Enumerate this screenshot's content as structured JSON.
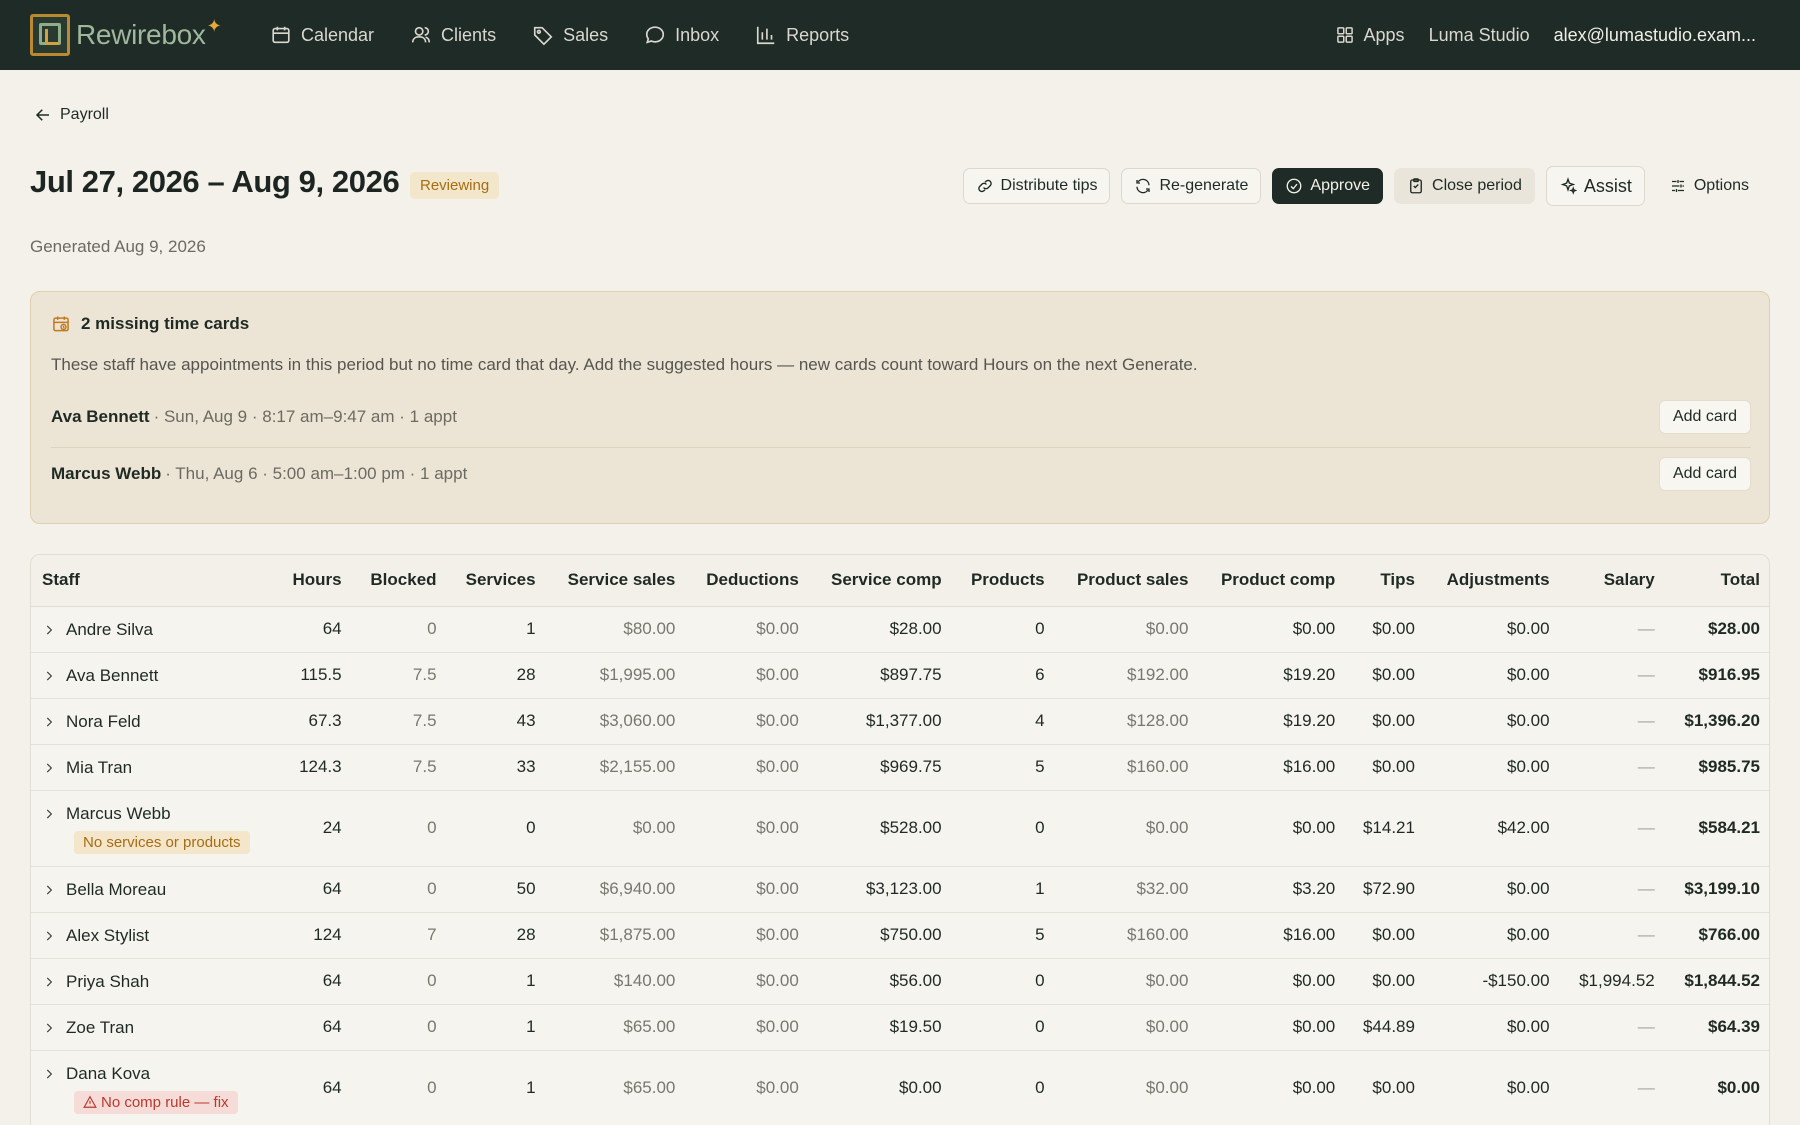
{
  "app": {
    "brand": "Rewirebox",
    "nav": [
      {
        "label": "Calendar",
        "icon": "calendar-icon"
      },
      {
        "label": "Clients",
        "icon": "users-icon"
      },
      {
        "label": "Sales",
        "icon": "tag-icon"
      },
      {
        "label": "Inbox",
        "icon": "chat-icon"
      },
      {
        "label": "Reports",
        "icon": "bar-chart-icon"
      }
    ],
    "apps_label": "Apps",
    "workspace": "Luma Studio",
    "user_email": "alex@lumastudio.exam..."
  },
  "breadcrumb": {
    "back_label": "Payroll"
  },
  "header": {
    "title": "Jul 27, 2026 – Aug 9, 2026",
    "status": "Reviewing",
    "generated": "Generated Aug 9, 2026",
    "actions": {
      "distribute_tips": "Distribute tips",
      "regenerate": "Re-generate",
      "approve": "Approve",
      "close_period": "Close period",
      "assist": "Assist",
      "options": "Options"
    }
  },
  "missing_cards": {
    "title": "2 missing time cards",
    "description": "These staff have appointments in this period but no time card that day. Add the suggested hours — new cards count toward Hours on the next Generate.",
    "items": [
      {
        "name": "Ava Bennett",
        "detail": "· Sun, Aug 9 · 8:17 am–9:47 am · 1 appt",
        "action": "Add card"
      },
      {
        "name": "Marcus Webb",
        "detail": "· Thu, Aug 6 · 5:00 am–1:00 pm · 1 appt",
        "action": "Add card"
      }
    ]
  },
  "table": {
    "columns": [
      "Staff",
      "Hours",
      "Blocked",
      "Services",
      "Service sales",
      "Deductions",
      "Service comp",
      "Products",
      "Product sales",
      "Product comp",
      "Tips",
      "Adjustments",
      "Salary",
      "Total"
    ],
    "rows": [
      {
        "staff": "Andre Silva",
        "hours": "64",
        "blocked": "0",
        "services": "1",
        "service_sales": "$80.00",
        "deductions": "$0.00",
        "service_comp": "$28.00",
        "products": "0",
        "product_sales": "$0.00",
        "product_comp": "$0.00",
        "tips": "$0.00",
        "adjustments": "$0.00",
        "salary": "—",
        "total": "$28.00"
      },
      {
        "staff": "Ava Bennett",
        "hours": "115.5",
        "blocked": "7.5",
        "services": "28",
        "service_sales": "$1,995.00",
        "deductions": "$0.00",
        "service_comp": "$897.75",
        "products": "6",
        "product_sales": "$192.00",
        "product_comp": "$19.20",
        "tips": "$0.00",
        "adjustments": "$0.00",
        "salary": "—",
        "total": "$916.95"
      },
      {
        "staff": "Nora Feld",
        "hours": "67.3",
        "blocked": "7.5",
        "services": "43",
        "service_sales": "$3,060.00",
        "deductions": "$0.00",
        "service_comp": "$1,377.00",
        "products": "4",
        "product_sales": "$128.00",
        "product_comp": "$19.20",
        "tips": "$0.00",
        "adjustments": "$0.00",
        "salary": "—",
        "total": "$1,396.20"
      },
      {
        "staff": "Mia Tran",
        "hours": "124.3",
        "blocked": "7.5",
        "services": "33",
        "service_sales": "$2,155.00",
        "deductions": "$0.00",
        "service_comp": "$969.75",
        "products": "5",
        "product_sales": "$160.00",
        "product_comp": "$16.00",
        "tips": "$0.00",
        "adjustments": "$0.00",
        "salary": "—",
        "total": "$985.75"
      },
      {
        "staff": "Marcus Webb",
        "note": "No services or products",
        "hours": "24",
        "blocked": "0",
        "services": "0",
        "service_sales": "$0.00",
        "deductions": "$0.00",
        "service_comp": "$528.00",
        "products": "0",
        "product_sales": "$0.00",
        "product_comp": "$0.00",
        "tips": "$14.21",
        "adjustments": "$42.00",
        "salary": "—",
        "total": "$584.21"
      },
      {
        "staff": "Bella Moreau",
        "hours": "64",
        "blocked": "0",
        "services": "50",
        "service_sales": "$6,940.00",
        "deductions": "$0.00",
        "service_comp": "$3,123.00",
        "products": "1",
        "product_sales": "$32.00",
        "product_comp": "$3.20",
        "tips": "$72.90",
        "adjustments": "$0.00",
        "salary": "—",
        "total": "$3,199.10"
      },
      {
        "staff": "Alex Stylist",
        "hours": "124",
        "blocked": "7",
        "services": "28",
        "service_sales": "$1,875.00",
        "deductions": "$0.00",
        "service_comp": "$750.00",
        "products": "5",
        "product_sales": "$160.00",
        "product_comp": "$16.00",
        "tips": "$0.00",
        "adjustments": "$0.00",
        "salary": "—",
        "total": "$766.00"
      },
      {
        "staff": "Priya Shah",
        "hours": "64",
        "blocked": "0",
        "services": "1",
        "service_sales": "$140.00",
        "deductions": "$0.00",
        "service_comp": "$56.00",
        "products": "0",
        "product_sales": "$0.00",
        "product_comp": "$0.00",
        "tips": "$0.00",
        "adjustments": "-$150.00",
        "salary": "$1,994.52",
        "total": "$1,844.52"
      },
      {
        "staff": "Zoe Tran",
        "hours": "64",
        "blocked": "0",
        "services": "1",
        "service_sales": "$65.00",
        "deductions": "$0.00",
        "service_comp": "$19.50",
        "products": "0",
        "product_sales": "$0.00",
        "product_comp": "$0.00",
        "tips": "$44.89",
        "adjustments": "$0.00",
        "salary": "—",
        "total": "$64.39"
      },
      {
        "staff": "Dana Kova",
        "error": "No comp rule — fix",
        "hours": "64",
        "blocked": "0",
        "services": "1",
        "service_sales": "$65.00",
        "deductions": "$0.00",
        "service_comp": "$0.00",
        "products": "0",
        "product_sales": "$0.00",
        "product_comp": "$0.00",
        "tips": "$0.00",
        "adjustments": "$0.00",
        "salary": "—",
        "total": "$0.00"
      }
    ]
  }
}
